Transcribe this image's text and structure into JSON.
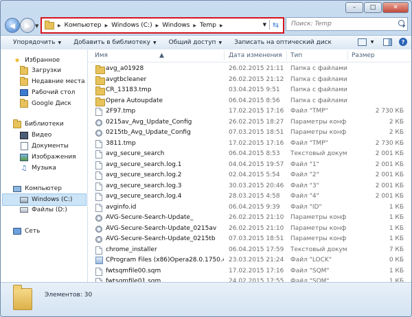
{
  "window": {
    "minimize_label": "–",
    "maximize_label": "□",
    "close_label": "✕"
  },
  "address_bar": {
    "crumbs": [
      "Компьютер",
      "Windows (C:)",
      "Windows",
      "Temp"
    ]
  },
  "search": {
    "placeholder": "Поиск: Temp"
  },
  "toolbar": {
    "organize": "Упорядочить",
    "add_to_library": "Добавить в библиотеку",
    "share": "Общий доступ",
    "burn": "Записать на оптический диск"
  },
  "sidebar": {
    "favorites": {
      "title": "Избранное",
      "items": [
        "Загрузки",
        "Недавние места",
        "Рабочий стол",
        "Google Диск"
      ]
    },
    "libraries": {
      "title": "Библиотеки",
      "items": [
        "Видео",
        "Документы",
        "Изображения",
        "Музыка"
      ]
    },
    "computer": {
      "title": "Компьютер",
      "items": [
        "Windows (C:)",
        "Файлы (D:)"
      ]
    },
    "network": "Сеть"
  },
  "columns": {
    "name": "Имя",
    "date": "Дата изменения",
    "type": "Тип",
    "size": "Размер"
  },
  "files": [
    {
      "name": "avg_a01928",
      "date": "26.02.2015 21:11",
      "type": "Папка с файлами",
      "size": "",
      "icon": "folder-icon"
    },
    {
      "name": "avgtbcleaner",
      "date": "26.02.2015 21:12",
      "type": "Папка с файлами",
      "size": "",
      "icon": "folder-icon"
    },
    {
      "name": "CR_13183.tmp",
      "date": "03.04.2015 9:51",
      "type": "Папка с файлами",
      "size": "",
      "icon": "folder-icon"
    },
    {
      "name": "Opera Autoupdate",
      "date": "06.04.2015 8:56",
      "type": "Папка с файлами",
      "size": "",
      "icon": "folder-icon"
    },
    {
      "name": "2F97.tmp",
      "date": "17.02.2015 17:16",
      "type": "Файл \"TMP\"",
      "size": "2 730 КБ",
      "icon": "document-icon"
    },
    {
      "name": "0215av_Avg_Update_Config",
      "date": "26.02.2015 18:27",
      "type": "Параметры конф...",
      "size": "2 КБ",
      "icon": "settings-file-icon"
    },
    {
      "name": "0215tb_Avg_Update_Config",
      "date": "07.03.2015 18:51",
      "type": "Параметры конф...",
      "size": "2 КБ",
      "icon": "settings-file-icon"
    },
    {
      "name": "3811.tmp",
      "date": "17.02.2015 17:16",
      "type": "Файл \"TMP\"",
      "size": "2 730 КБ",
      "icon": "document-icon"
    },
    {
      "name": "avg_secure_search",
      "date": "06.04.2015 8:53",
      "type": "Текстовый докум...",
      "size": "2 001 КБ",
      "icon": "document-icon"
    },
    {
      "name": "avg_secure_search.log.1",
      "date": "04.04.2015 19:57",
      "type": "Файл \"1\"",
      "size": "2 001 КБ",
      "icon": "document-icon"
    },
    {
      "name": "avg_secure_search.log.2",
      "date": "02.04.2015 5:54",
      "type": "Файл \"2\"",
      "size": "2 001 КБ",
      "icon": "document-icon"
    },
    {
      "name": "avg_secure_search.log.3",
      "date": "30.03.2015 20:46",
      "type": "Файл \"3\"",
      "size": "2 001 КБ",
      "icon": "document-icon"
    },
    {
      "name": "avg_secure_search.log.4",
      "date": "28.03.2015 4:58",
      "type": "Файл \"4\"",
      "size": "2 001 КБ",
      "icon": "document-icon"
    },
    {
      "name": "avginfo.id",
      "date": "06.04.2015 9:39",
      "type": "Файл \"ID\"",
      "size": "1 КБ",
      "icon": "document-icon"
    },
    {
      "name": "AVG-Secure-Search-Update_",
      "date": "26.02.2015 21:10",
      "type": "Параметры конф...",
      "size": "1 КБ",
      "icon": "settings-file-icon"
    },
    {
      "name": "AVG-Secure-Search-Update_0215av",
      "date": "26.02.2015 21:10",
      "type": "Параметры конф...",
      "size": "1 КБ",
      "icon": "settings-file-icon"
    },
    {
      "name": "AVG-Secure-Search-Update_0215tb",
      "date": "07.03.2015 18:51",
      "type": "Параметры конф...",
      "size": "1 КБ",
      "icon": "settings-file-icon"
    },
    {
      "name": "chrome_installer",
      "date": "06.04.2015 17:59",
      "type": "Текстовый докум...",
      "size": "7 КБ",
      "icon": "document-icon"
    },
    {
      "name": "CProgram Files (x86)Opera28.0.1750.48op...",
      "date": "23.03.2015 21:24",
      "type": "Файл \"LOCK\"",
      "size": "0 КБ",
      "icon": "application-icon"
    },
    {
      "name": "fwtsqmfile00.sqm",
      "date": "17.02.2015 17:16",
      "type": "Файл \"SQM\"",
      "size": "1 КБ",
      "icon": "document-icon"
    },
    {
      "name": "fwtsqmfile01.sqm",
      "date": "24.02.2015 17:55",
      "type": "Файл \"SQM\"",
      "size": "1 КБ",
      "icon": "document-icon"
    }
  ],
  "status": {
    "items_count": "Элементов: 30"
  }
}
